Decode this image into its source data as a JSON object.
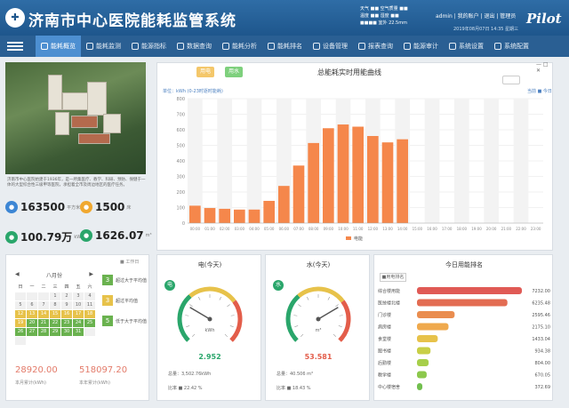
{
  "header": {
    "title": "济南市中心医院能耗监管系统",
    "brand": "Pilot",
    "info_rows": [
      "天气 ■■ 空气质量 ■■",
      "温度 ■■ 湿度 ■■",
      "■■■■ 室外 22.5mm"
    ],
    "user_links": "admin | 我的账户 | 退出 | 管理员",
    "datetime": "2019年08月07日 14:35 星期三"
  },
  "nav": {
    "items": [
      {
        "label": "能耗概览",
        "active": true
      },
      {
        "label": "能耗监测"
      },
      {
        "label": "能源指标"
      },
      {
        "label": "数据查询"
      },
      {
        "label": "能耗分析"
      },
      {
        "label": "能耗排名"
      },
      {
        "label": "设备管理"
      },
      {
        "label": "报表查询"
      },
      {
        "label": "能源审计"
      },
      {
        "label": "系统设置"
      },
      {
        "label": "系统配置"
      }
    ]
  },
  "info": {
    "description": "济南市中心医院始建于1936年，是一所集医疗、教学、科研、预防、保健于一体的大型综合性三级甲等医院，承担着全市及周边地区的医疗任务。",
    "stats": [
      {
        "value": "163500",
        "unit": "平方米",
        "icon": "area-icon",
        "color": "#3d86d4"
      },
      {
        "value": "1500",
        "unit": "床",
        "icon": "bed-icon",
        "color": "#f0a830"
      },
      {
        "value": "100.79万",
        "unit": "kWh",
        "icon": "electric-icon",
        "color": "#2aa66b"
      },
      {
        "value": "1626.07",
        "unit": "m³",
        "icon": "water-icon",
        "color": "#2aa66b"
      }
    ]
  },
  "calendar": {
    "tab": "■ 工作日",
    "month": "八月份",
    "weekdays": [
      "日",
      "一",
      "二",
      "三",
      "四",
      "五",
      "六"
    ],
    "cells": [
      "",
      "",
      "",
      "1",
      "2",
      "3",
      "4",
      "5",
      "6",
      "7",
      "8",
      "9",
      "10",
      "11",
      "12",
      "13",
      "14",
      "15",
      "16",
      "17",
      "18",
      "19",
      "20",
      "21",
      "22",
      "23",
      "24",
      "25",
      "26",
      "27",
      "28",
      "29",
      "30",
      "31",
      "",
      ""
    ],
    "cell_states": [
      "e",
      "e",
      "e",
      "n",
      "n",
      "n",
      "n",
      "n",
      "n",
      "n",
      "n",
      "n",
      "n",
      "n",
      "y",
      "y",
      "y",
      "y",
      "y",
      "y",
      "y",
      "y",
      "g",
      "g",
      "g",
      "g",
      "g",
      "g",
      "g",
      "g",
      "g",
      "g",
      "g",
      "g",
      "e",
      "e"
    ],
    "legend": [
      {
        "num": "3",
        "label": "超过大于平均值",
        "color": "#6ab24f"
      },
      {
        "num": "3",
        "label": "超过平均值",
        "color": "#e7c24a"
      },
      {
        "num": "5",
        "label": "低于大于平均值",
        "color": "#6ab24f"
      }
    ],
    "totals": [
      {
        "value": "28920.00",
        "label": "本月累计(kWh)"
      },
      {
        "value": "518097.20",
        "label": "本年累计(kWh)"
      }
    ]
  },
  "chart": {
    "btn_a": "用电",
    "btn_b": "用水",
    "title": "总能耗实时用能曲线",
    "subtitle": "单位：kWh  (0-23时逐时能耗)",
    "right_label": "当前 ■ 今日",
    "legend": "电能"
  },
  "chart_data": {
    "type": "bar",
    "categories": [
      "00:00",
      "01:00",
      "02:00",
      "03:00",
      "04:00",
      "05:00",
      "06:00",
      "07:00",
      "08:00",
      "09:00",
      "10:00",
      "11:00",
      "12:00",
      "13:00",
      "14:00",
      "15:00",
      "16:00",
      "17:00",
      "18:00",
      "19:00",
      "20:00",
      "21:00",
      "22:00",
      "23:00"
    ],
    "values": [
      112,
      97,
      92,
      87,
      87,
      143,
      239,
      370,
      515,
      610,
      634,
      620,
      560,
      519,
      539,
      0,
      0,
      0,
      0,
      0,
      0,
      0,
      0,
      0
    ],
    "ylim": [
      0,
      800
    ],
    "yticks": [
      "0",
      "100",
      "200",
      "300",
      "400",
      "500",
      "600",
      "700",
      "800"
    ],
    "grid": true,
    "legend_position": "bottom",
    "color": "#f5874b"
  },
  "gauges": [
    {
      "title": "电(今天)",
      "value": "2.952",
      "unit": "kWh",
      "badge": "电",
      "color": "#2aa66b",
      "value_color": "#2aa66b",
      "fraction": 0.28,
      "row1": "总量：3,502.76kWh",
      "row2": "比率 ■ 22.42 %"
    },
    {
      "title": "水(今天)",
      "value": "53.581",
      "unit": "m³",
      "badge": "水",
      "color": "#2aa66b",
      "value_color": "#e35d4a",
      "fraction": 0.72,
      "row1": "总量：40.506 m³",
      "row2": "比率 ■ 18.43 %"
    }
  ],
  "ranking": {
    "title": "今日用能排名",
    "tab": "■用电排名",
    "items": [
      {
        "name": "综合楼用能",
        "value": "7232.00",
        "v": 7232,
        "color": "#e05a55"
      },
      {
        "name": "医技楼北楼",
        "value": "6235.48",
        "v": 6235,
        "color": "#e36c52"
      },
      {
        "name": "门诊楼",
        "value": "2595.46",
        "v": 2595,
        "color": "#ea8d4f"
      },
      {
        "name": "病房楼",
        "value": "2175.10",
        "v": 2175,
        "color": "#efa94d"
      },
      {
        "name": "食堂楼",
        "value": "1433.04",
        "v": 1433,
        "color": "#e7c24a"
      },
      {
        "name": "图书楼",
        "value": "934.38",
        "v": 934,
        "color": "#c8cf47"
      },
      {
        "name": "后勤楼",
        "value": "804.00",
        "v": 804,
        "color": "#a7cf4a"
      },
      {
        "name": "教学楼",
        "value": "670.05",
        "v": 670,
        "color": "#8cc84c"
      },
      {
        "name": "中心楼宿舍",
        "value": "372.69",
        "v": 372,
        "color": "#72bf4f"
      }
    ]
  }
}
